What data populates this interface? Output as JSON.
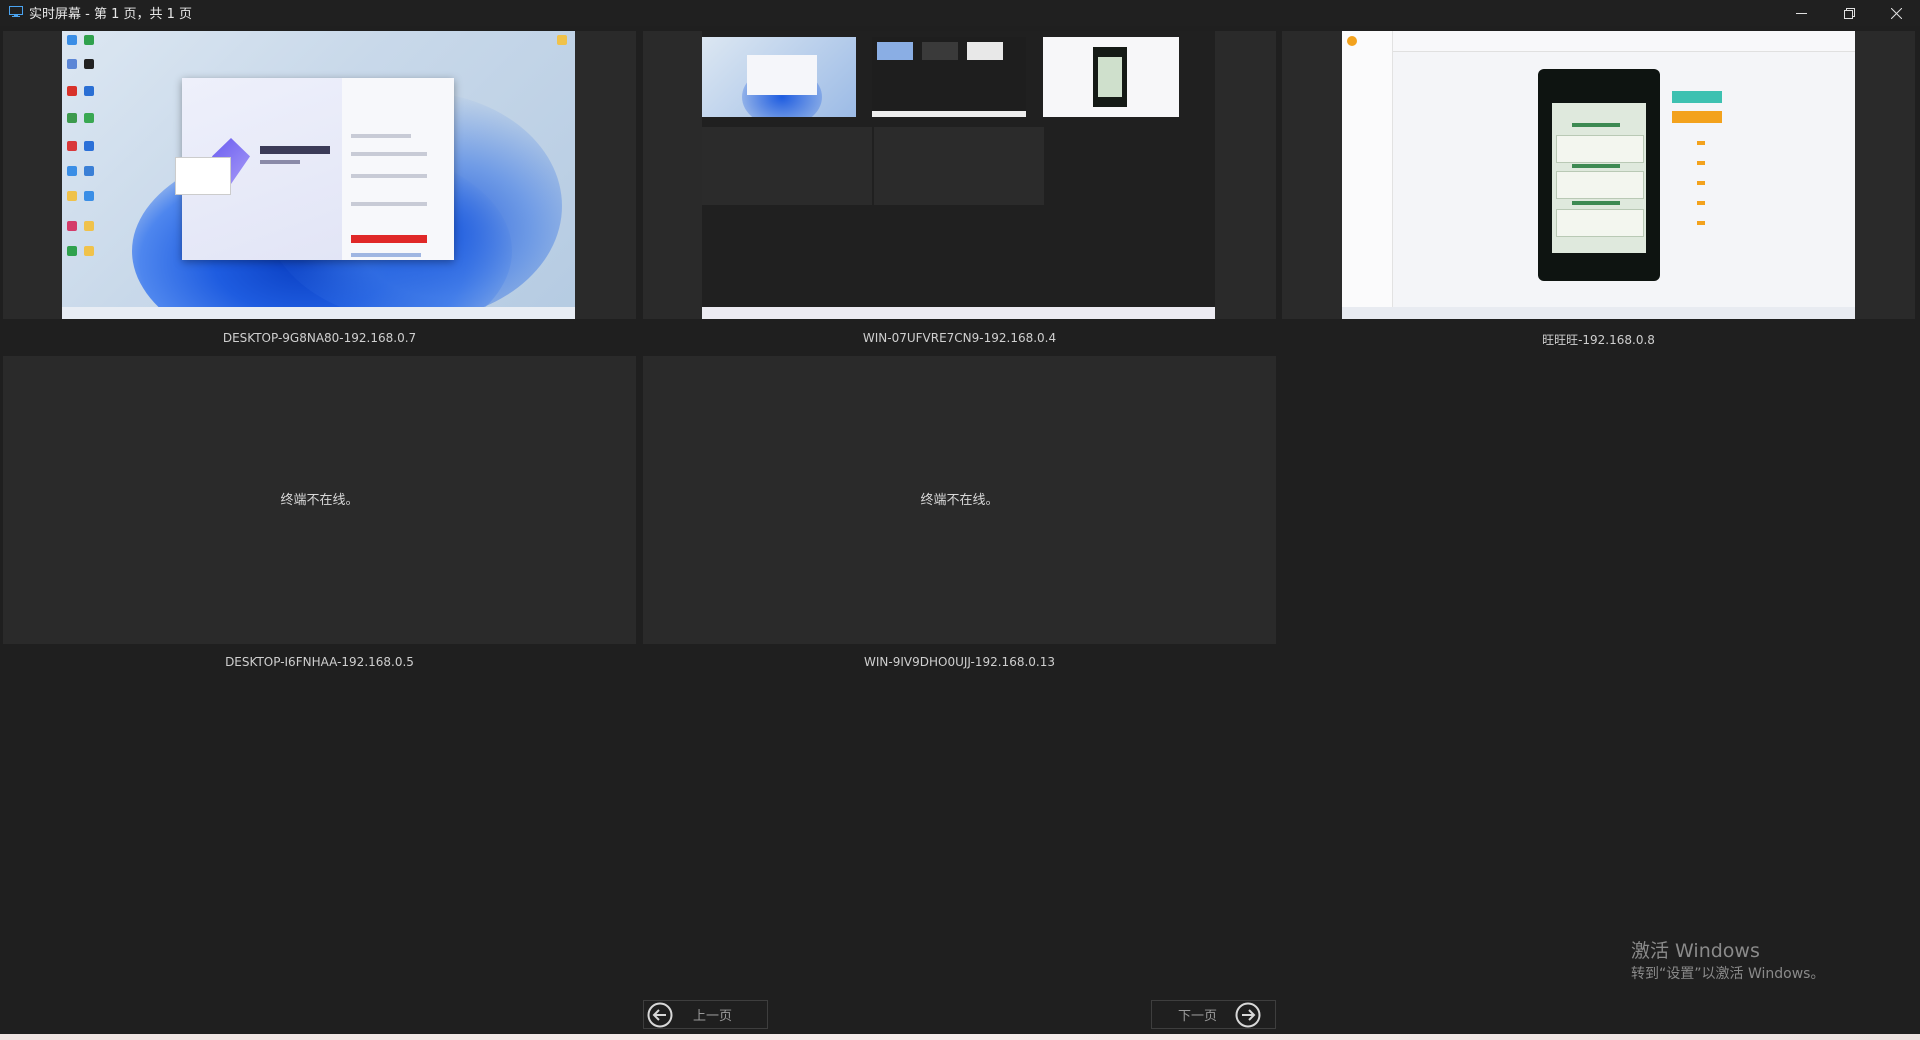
{
  "window": {
    "title": "实时屏幕 - 第 1 页，共 1 页",
    "icon": "monitor-icon",
    "controls": [
      "minimize-icon",
      "restore-icon",
      "close-icon"
    ]
  },
  "tiles": [
    {
      "label": "DESKTOP-9G8NA80-192.168.0.7",
      "status": "online"
    },
    {
      "label": "WIN-07UFVRE7CN9-192.168.0.4",
      "status": "online"
    },
    {
      "label": "旺旺旺-192.168.0.8",
      "status": "online"
    },
    {
      "label": "DESKTOP-I6FNHAA-192.168.0.5",
      "status": "offline",
      "message": "终端不在线。"
    },
    {
      "label": "WIN-9IV9DHO0UJJ-192.168.0.13",
      "status": "offline",
      "message": "终端不在线。"
    }
  ],
  "watermark": {
    "line1": "激活 Windows",
    "line2": "转到“设置”以激活 Windows。"
  },
  "pager": {
    "prev_label": "上一页",
    "next_label": "下一页",
    "prev_icon": "arrow-left-circle-icon",
    "next_icon": "arrow-right-circle-icon"
  },
  "colors": {
    "background": "#1f1f1f",
    "tile_background": "#2a2a2a",
    "text": "#cfcfcf"
  }
}
